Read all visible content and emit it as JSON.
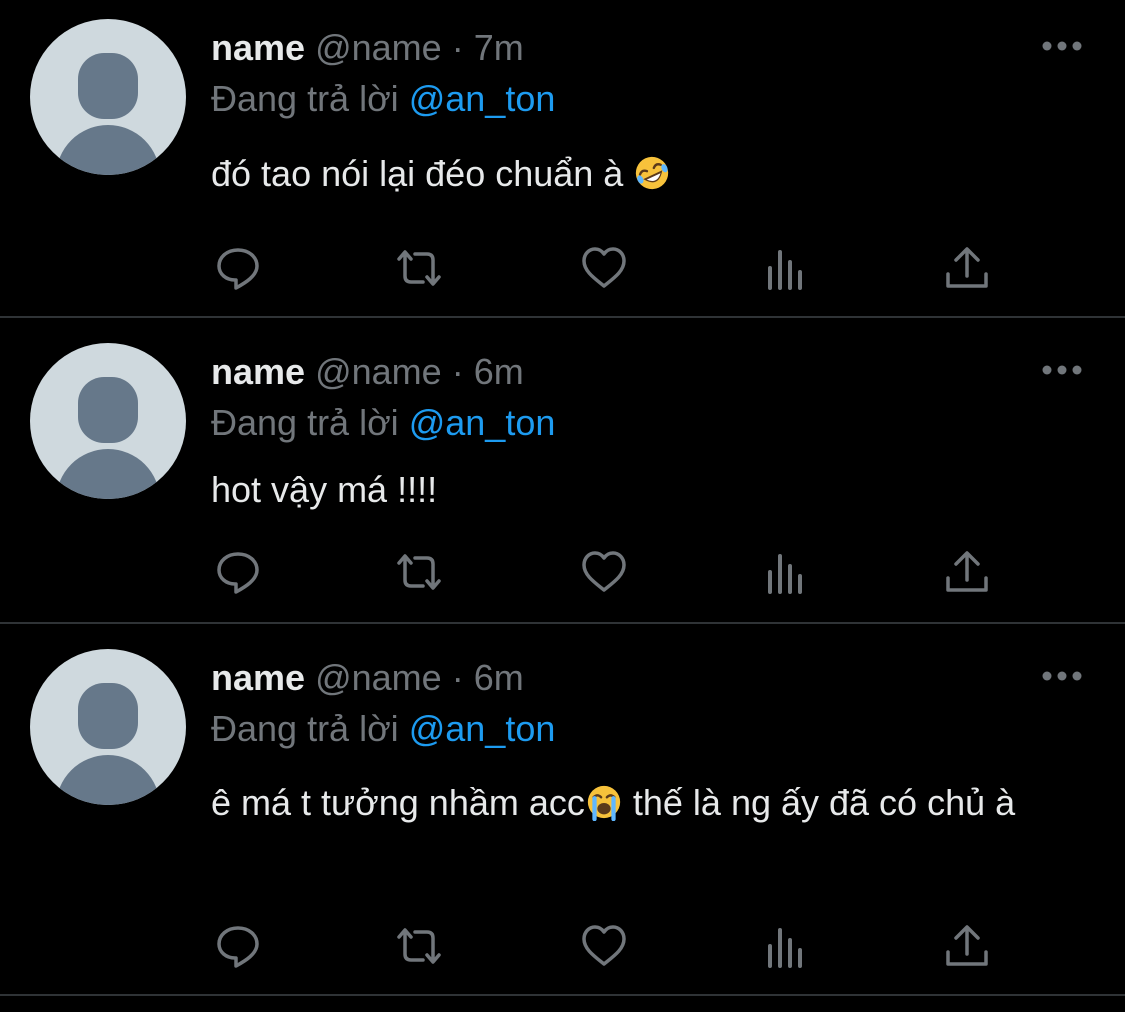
{
  "colors": {
    "background": "#000000",
    "text_primary": "#e7e9ea",
    "text_secondary": "#71767b",
    "link": "#1d9bf0",
    "divider": "#2f3336",
    "avatar_bg": "#cfd9de",
    "avatar_fg": "#66788a"
  },
  "tweets": [
    {
      "display_name": "name",
      "handle": "@name",
      "separator": "·",
      "time": "7m",
      "reply_prefix": "Đang trả lời",
      "reply_to": "@an_ton",
      "text": "đó tao nói lại đéo chuẩn à",
      "emoji": "rolling-on-floor-laughing-emoji",
      "text_continued": "",
      "actions": [
        "reply-icon",
        "retweet-icon",
        "like-icon",
        "views-icon",
        "share-icon"
      ]
    },
    {
      "display_name": "name",
      "handle": "@name",
      "separator": "·",
      "time": "6m",
      "reply_prefix": "Đang trả lời",
      "reply_to": "@an_ton",
      "text": "hot vậy má !!!!",
      "emoji": "",
      "text_continued": "",
      "actions": [
        "reply-icon",
        "retweet-icon",
        "like-icon",
        "views-icon",
        "share-icon"
      ]
    },
    {
      "display_name": "name",
      "handle": "@name",
      "separator": "·",
      "time": "6m",
      "reply_prefix": "Đang trả lời",
      "reply_to": "@an_ton",
      "text": "ê má t tưởng nhầm acc",
      "emoji": "loudly-crying-face-emoji",
      "text_continued": " thế là ng ấy đã có chủ à",
      "actions": [
        "reply-icon",
        "retweet-icon",
        "like-icon",
        "views-icon",
        "share-icon"
      ]
    }
  ]
}
